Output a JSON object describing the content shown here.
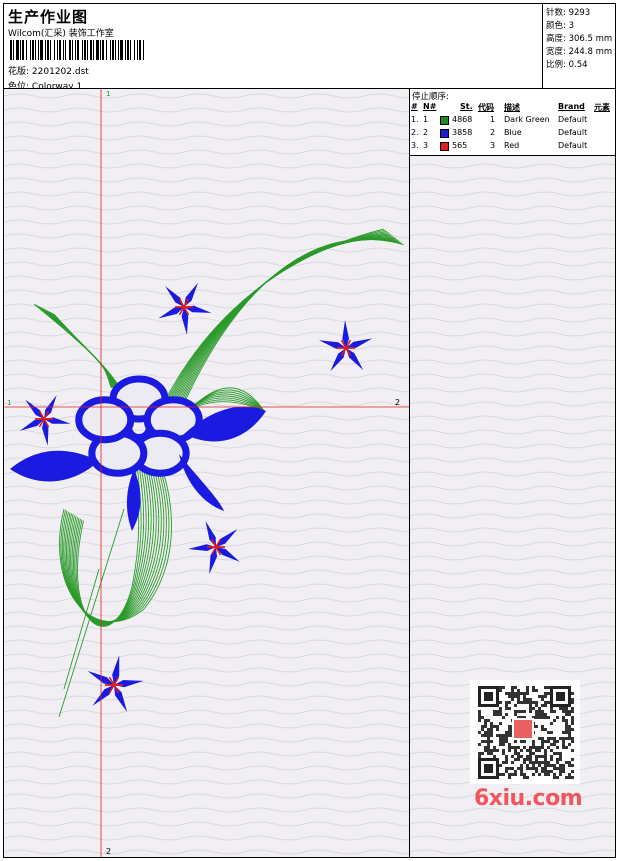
{
  "header": {
    "title": "生产作业图",
    "company": "Wilcom(汇采) 装饰工作室",
    "design_label": "花版:",
    "design_value": "2201202.dst",
    "colorway_label": "色位:",
    "colorway_value": "Colorway 1"
  },
  "stats": {
    "stitches_label": "针数:",
    "stitches_value": "9293",
    "colors_label": "颜色:",
    "colors_value": "3",
    "height_label": "高度:",
    "height_value": "306.5 mm",
    "width_label": "宽度:",
    "width_value": "244.8 mm",
    "scale_label": "比例:",
    "scale_value": "0.54"
  },
  "stop_sequence": {
    "title": "停止顺序:",
    "columns": [
      "#",
      "N#",
      "St.",
      "代码",
      "描述",
      "Brand",
      "元素"
    ],
    "rows": [
      {
        "num": "1.",
        "n": "1",
        "color": "#1e8c1e",
        "stitches": "4868",
        "code": "1",
        "desc": "Dark Green",
        "brand": "Default"
      },
      {
        "num": "2.",
        "n": "2",
        "color": "#1c1cd8",
        "stitches": "3858",
        "code": "2",
        "desc": "Blue",
        "brand": "Default"
      },
      {
        "num": "3.",
        "n": "3",
        "color": "#e02020",
        "stitches": "565",
        "code": "3",
        "desc": "Red",
        "brand": "Default"
      }
    ]
  },
  "guides": {
    "top_label": "1",
    "bottom_label": "2",
    "left_label": "1",
    "right_label": "2"
  },
  "watermark": {
    "site": "6xiu.com"
  },
  "colors": {
    "green": "#2a9a2a",
    "blue": "#1a1ae0",
    "red": "#e01818",
    "guide": "#e02020"
  }
}
